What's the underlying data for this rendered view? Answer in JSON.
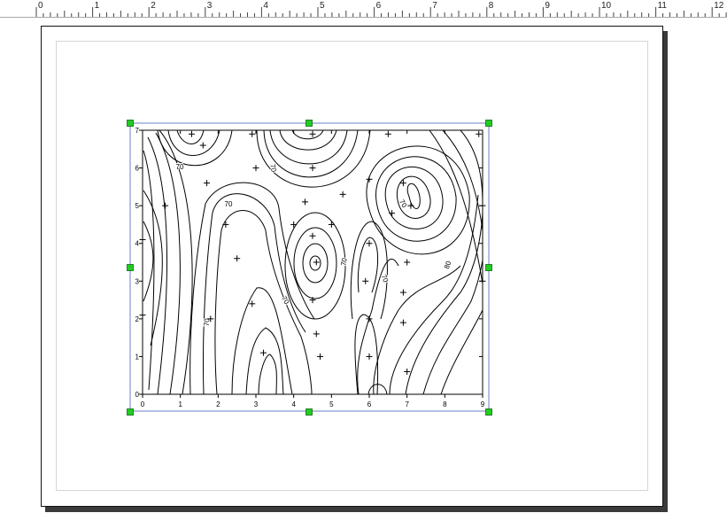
{
  "ruler": {
    "labels": [
      "0",
      "1",
      "2",
      "3",
      "4",
      "5",
      "6",
      "7",
      "8",
      "9",
      "10",
      "11",
      "12"
    ]
  },
  "chart_data": {
    "type": "contour",
    "xlim": [
      0,
      9
    ],
    "ylim": [
      0,
      7
    ],
    "x_tick_labels": [
      "0",
      "1",
      "2",
      "3",
      "4",
      "5",
      "6",
      "7",
      "8",
      "9"
    ],
    "y_tick_labels": [
      "0",
      "1",
      "2",
      "3",
      "4",
      "5",
      "6",
      "7"
    ],
    "contour_labels": [
      "70",
      "70",
      "70",
      "70",
      "70",
      "70",
      "70",
      "80"
    ],
    "points": [
      {
        "x": 1.3,
        "y": 6.9
      },
      {
        "x": 1.6,
        "y": 6.6
      },
      {
        "x": 2.9,
        "y": 6.9
      },
      {
        "x": 4.5,
        "y": 6.9
      },
      {
        "x": 6.5,
        "y": 6.9
      },
      {
        "x": 8.9,
        "y": 6.9
      },
      {
        "x": 3.0,
        "y": 6.0
      },
      {
        "x": 4.5,
        "y": 6.0
      },
      {
        "x": 1.7,
        "y": 5.6
      },
      {
        "x": 0.6,
        "y": 5.0
      },
      {
        "x": 4.3,
        "y": 5.1
      },
      {
        "x": 5.3,
        "y": 5.3
      },
      {
        "x": 6.0,
        "y": 5.7
      },
      {
        "x": 6.9,
        "y": 5.6
      },
      {
        "x": 7.1,
        "y": 5.0
      },
      {
        "x": 6.6,
        "y": 4.8
      },
      {
        "x": 2.2,
        "y": 4.5
      },
      {
        "x": 4.0,
        "y": 4.5
      },
      {
        "x": 5.0,
        "y": 4.5
      },
      {
        "x": 4.5,
        "y": 4.2
      },
      {
        "x": 6.0,
        "y": 4.0
      },
      {
        "x": 0.0,
        "y": 4.1
      },
      {
        "x": 2.5,
        "y": 3.6
      },
      {
        "x": 4.6,
        "y": 3.5
      },
      {
        "x": 7.0,
        "y": 3.5
      },
      {
        "x": 5.9,
        "y": 3.0
      },
      {
        "x": 6.9,
        "y": 2.7
      },
      {
        "x": 2.9,
        "y": 2.4
      },
      {
        "x": 4.5,
        "y": 2.5
      },
      {
        "x": 0.0,
        "y": 2.1
      },
      {
        "x": 1.8,
        "y": 2.0
      },
      {
        "x": 6.0,
        "y": 2.0
      },
      {
        "x": 6.9,
        "y": 1.9
      },
      {
        "x": 4.6,
        "y": 1.6
      },
      {
        "x": 3.2,
        "y": 1.1
      },
      {
        "x": 4.7,
        "y": 1.0
      },
      {
        "x": 6.0,
        "y": 1.0
      },
      {
        "x": 7.0,
        "y": 0.6
      },
      {
        "x": 9.0,
        "y": 3.0
      },
      {
        "x": 9.0,
        "y": 5.0
      }
    ]
  }
}
